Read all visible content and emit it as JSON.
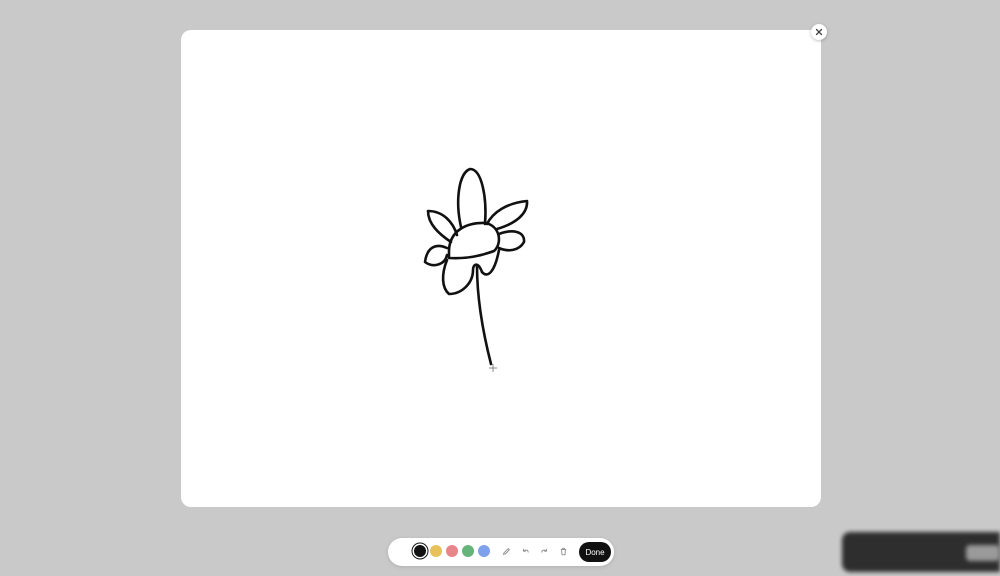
{
  "sketch": {
    "close_icon": "close-icon",
    "stroke_color": "#111111"
  },
  "toolbar": {
    "swatches": [
      {
        "name": "black",
        "color": "#111111",
        "selected": true
      },
      {
        "name": "yellow",
        "color": "#e8c15a",
        "selected": false
      },
      {
        "name": "red",
        "color": "#e8858a",
        "selected": false
      },
      {
        "name": "green",
        "color": "#65b57a",
        "selected": false
      },
      {
        "name": "blue",
        "color": "#7fa0ea",
        "selected": false
      }
    ],
    "tools": [
      "pencil-icon",
      "undo-icon",
      "redo-icon",
      "trash-icon"
    ],
    "done_label": "Done"
  }
}
